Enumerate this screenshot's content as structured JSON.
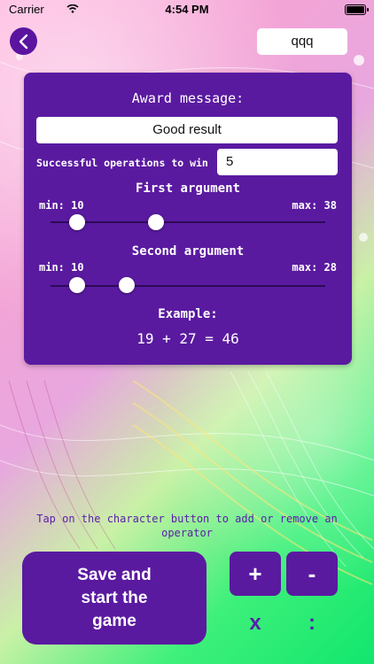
{
  "status_bar": {
    "carrier": "Carrier",
    "time": "4:54 PM"
  },
  "top_bar": {
    "name_value": "qqq"
  },
  "settings": {
    "award_title": "Award message:",
    "award_value": "Good result",
    "ops_label": "Successful operations to win",
    "ops_value": "5",
    "first_argument": {
      "heading": "First argument",
      "min_label": "min: 10",
      "max_label": "max: 38",
      "min": 10,
      "max": 38
    },
    "second_argument": {
      "heading": "Second argument",
      "min_label": "min: 10",
      "max_label": "max: 28",
      "min": 10,
      "max": 28
    },
    "example_label": "Example:",
    "example_text": "19 + 27 = 46"
  },
  "hint": "Tap on the character button to add or remove an operator",
  "save_button_label": "Save and start the game",
  "operators": {
    "plus": "+",
    "minus": "-",
    "multiply": "x",
    "divide": ":"
  },
  "colors": {
    "panel": "#5a1aa0",
    "hint_text": "#5a20a8"
  },
  "icons": {
    "back": "chevron-left-icon",
    "wifi": "wifi-icon",
    "battery": "battery-icon"
  }
}
